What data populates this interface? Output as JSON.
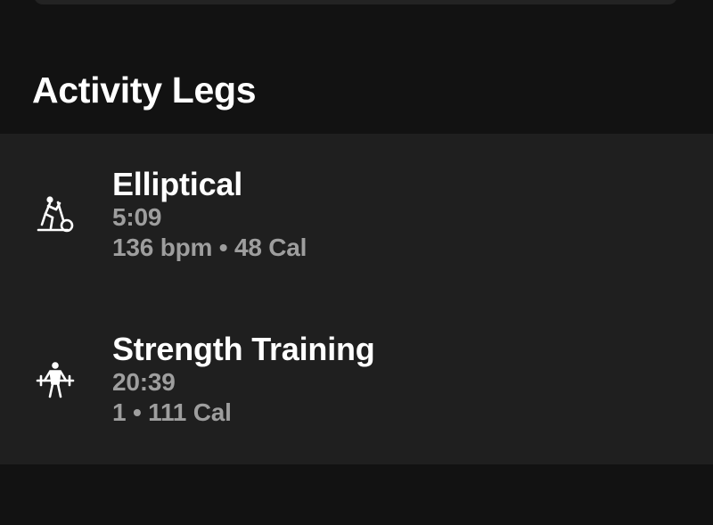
{
  "section": {
    "title": "Activity Legs"
  },
  "activities": [
    {
      "icon": "elliptical-icon",
      "name": "Elliptical",
      "duration": "5:09",
      "stats": "136 bpm • 48 Cal"
    },
    {
      "icon": "strength-training-icon",
      "name": "Strength Training",
      "duration": "20:39",
      "stats": "1 • 111 Cal"
    }
  ],
  "colors": {
    "background": "#121212",
    "card": "#1f1f1f",
    "primary_text": "#ffffff",
    "secondary_text": "#9e9e9e"
  }
}
